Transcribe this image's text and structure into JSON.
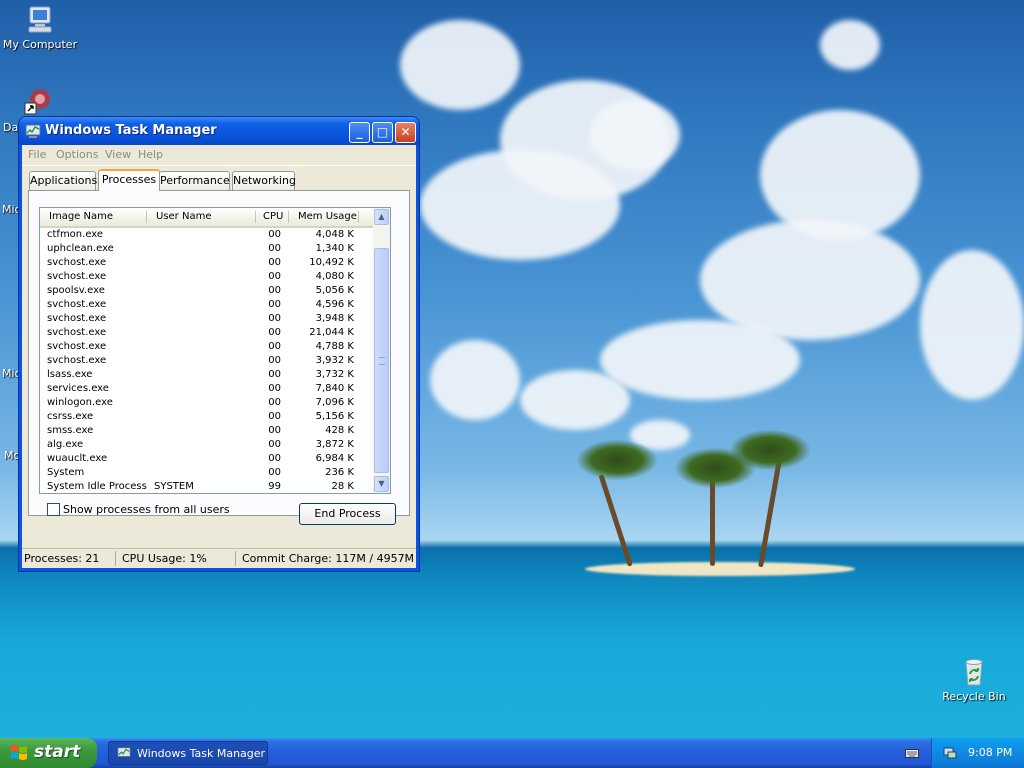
{
  "desktop": {
    "icons": [
      {
        "label": "My Computer",
        "icon": "my-computer-icon"
      },
      {
        "label": "Recycle Bin",
        "icon": "recycle-bin-icon"
      }
    ],
    "partial_labels": [
      "Da",
      "Mic",
      "Mic",
      "Mc"
    ]
  },
  "window": {
    "title": "Windows Task Manager",
    "buttons": {
      "minimize": "_",
      "maximize": "□",
      "close": "✕"
    },
    "menu": [
      "File",
      "Options",
      "View",
      "Help"
    ],
    "tabs": [
      "Applications",
      "Processes",
      "Performance",
      "Networking"
    ],
    "active_tab": "Processes",
    "columns": [
      "Image Name",
      "User Name",
      "CPU",
      "Mem Usage"
    ],
    "processes": [
      {
        "name": "ctfmon.exe",
        "user": "",
        "cpu": "00",
        "mem": "4,048 K"
      },
      {
        "name": "uphclean.exe",
        "user": "",
        "cpu": "00",
        "mem": "1,340 K"
      },
      {
        "name": "svchost.exe",
        "user": "",
        "cpu": "00",
        "mem": "10,492 K"
      },
      {
        "name": "svchost.exe",
        "user": "",
        "cpu": "00",
        "mem": "4,080 K"
      },
      {
        "name": "spoolsv.exe",
        "user": "",
        "cpu": "00",
        "mem": "5,056 K"
      },
      {
        "name": "svchost.exe",
        "user": "",
        "cpu": "00",
        "mem": "4,596 K"
      },
      {
        "name": "svchost.exe",
        "user": "",
        "cpu": "00",
        "mem": "3,948 K"
      },
      {
        "name": "svchost.exe",
        "user": "",
        "cpu": "00",
        "mem": "21,044 K"
      },
      {
        "name": "svchost.exe",
        "user": "",
        "cpu": "00",
        "mem": "4,788 K"
      },
      {
        "name": "svchost.exe",
        "user": "",
        "cpu": "00",
        "mem": "3,932 K"
      },
      {
        "name": "lsass.exe",
        "user": "",
        "cpu": "00",
        "mem": "3,732 K"
      },
      {
        "name": "services.exe",
        "user": "",
        "cpu": "00",
        "mem": "7,840 K"
      },
      {
        "name": "winlogon.exe",
        "user": "",
        "cpu": "00",
        "mem": "7,096 K"
      },
      {
        "name": "csrss.exe",
        "user": "",
        "cpu": "00",
        "mem": "5,156 K"
      },
      {
        "name": "smss.exe",
        "user": "",
        "cpu": "00",
        "mem": "428 K"
      },
      {
        "name": "alg.exe",
        "user": "",
        "cpu": "00",
        "mem": "3,872 K"
      },
      {
        "name": "wuauclt.exe",
        "user": "",
        "cpu": "00",
        "mem": "6,984 K"
      },
      {
        "name": "System",
        "user": "",
        "cpu": "00",
        "mem": "236 K"
      },
      {
        "name": "System Idle Process",
        "user": "SYSTEM",
        "cpu": "99",
        "mem": "28 K"
      }
    ],
    "show_all_label": "Show processes from all users",
    "show_all_checked": false,
    "end_process_label": "End Process",
    "status": {
      "processes": "Processes: 21",
      "cpu": "CPU Usage: 1%",
      "commit": "Commit Charge: 117M / 4957M"
    }
  },
  "taskbar": {
    "start_label": "start",
    "task_button_label": "Windows Task Manager",
    "clock": "9:08 PM"
  },
  "colors": {
    "title_blue": "#0a53da",
    "taskbar_blue": "#245edb",
    "start_green": "#3c9a3c",
    "window_face": "#ece9d8",
    "active_tab_accent": "#f5a836"
  }
}
